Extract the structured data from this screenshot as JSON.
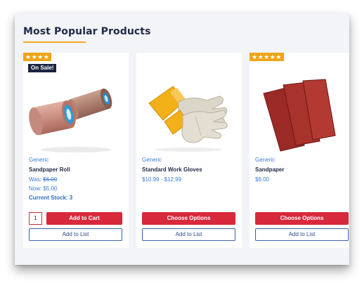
{
  "section": {
    "title": "Most Popular Products",
    "accent_color": "#f5a623"
  },
  "products": [
    {
      "rating_stars": "★★★★",
      "rating": 4,
      "badge": "On Sale!",
      "image_icon": "sandpaper-roll-image",
      "brand": "Generic",
      "name": "Sandpaper Roll",
      "was_label": "Was:",
      "was_price": "$6.00",
      "now_label": "Now:",
      "now_price": "$5.00",
      "stock_text": "Current Stock: 3",
      "quantity": "1",
      "primary_button": "Add to Cart",
      "secondary_button": "Add to List"
    },
    {
      "image_icon": "work-gloves-image",
      "brand": "Generic",
      "name": "Standard Work Gloves",
      "price": "$10.99 - $12.99",
      "primary_button": "Choose Options",
      "secondary_button": "Add to List"
    },
    {
      "rating_stars": "★★★★★",
      "rating": 5,
      "image_icon": "sandpaper-sheets-image",
      "brand": "Generic",
      "name": "Sandpaper",
      "price": "$9.00",
      "primary_button": "Choose Options",
      "secondary_button": "Add to List"
    }
  ],
  "colors": {
    "primary_red": "#d8283c",
    "link_blue": "#3a7bd5",
    "badge_navy": "#1b2340",
    "star_orange": "#f0a416"
  }
}
